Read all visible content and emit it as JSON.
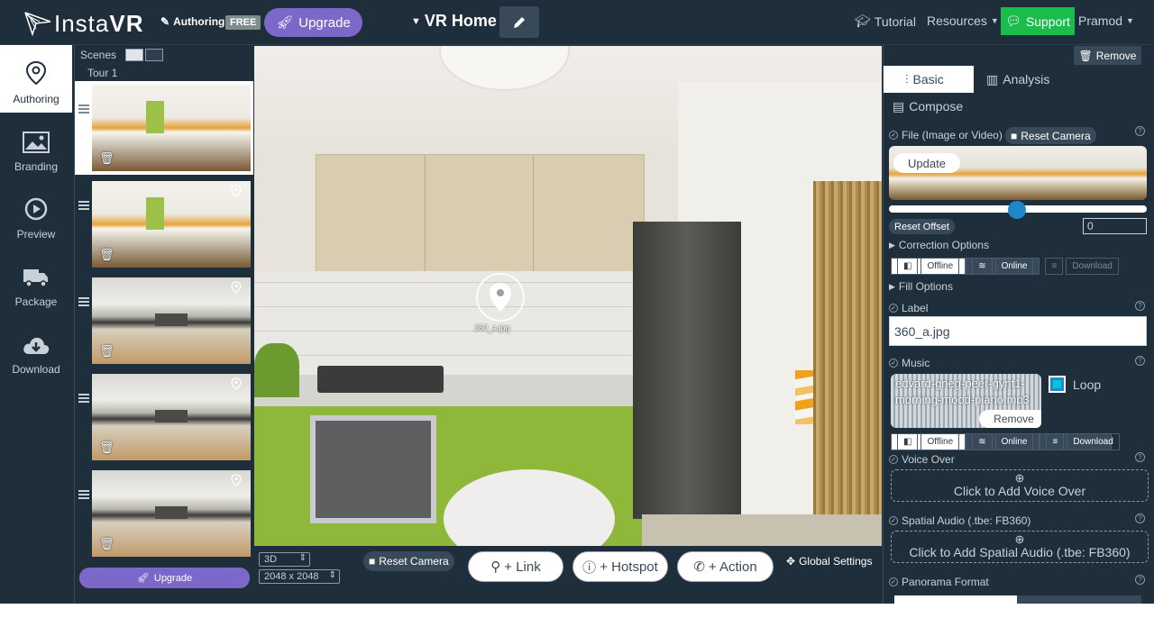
{
  "header": {
    "logo_text_light": "Insta",
    "logo_text_bold": "VR",
    "authoring_tag": "Authoring",
    "free_badge": "FREE",
    "upgrade_label": "Upgrade",
    "project_title": "VR Home",
    "tutorial_label": "Tutorial",
    "resources_label": "Resources",
    "support_label": "Support",
    "user_label": "Pramod"
  },
  "left_nav": {
    "items": [
      {
        "label": "Authoring",
        "icon": "location-pin-icon",
        "active": true
      },
      {
        "label": "Branding",
        "icon": "image-icon",
        "active": false
      },
      {
        "label": "Preview",
        "icon": "play-circle-icon",
        "active": false
      },
      {
        "label": "Package",
        "icon": "truck-icon",
        "active": false
      },
      {
        "label": "Download",
        "icon": "cloud-download-icon",
        "active": false
      }
    ]
  },
  "scenes": {
    "title": "Scenes",
    "tour_label": "Tour 1",
    "upgrade_label": "Upgrade",
    "items": [
      {
        "thumb": "warm",
        "selected": true,
        "pin": false
      },
      {
        "thumb": "warm",
        "selected": false,
        "pin": true
      },
      {
        "thumb": "cool",
        "selected": false,
        "pin": true
      },
      {
        "thumb": "cool",
        "selected": false,
        "pin": true
      },
      {
        "thumb": "cool",
        "selected": false,
        "pin": true
      }
    ]
  },
  "viewer": {
    "hotspot_label": "360_a.jpg",
    "mode_select": "3D",
    "resolution_select": "2048 x 2048",
    "reset_camera_label": "Reset Camera",
    "link_label": "+ Link",
    "hotspot_button_label": "+ Hotspot",
    "action_label": "+ Action",
    "global_settings_label": "Global Settings"
  },
  "right_panel": {
    "remove_label": "Remove",
    "tabs": {
      "basic": "Basic",
      "analysis": "Analysis",
      "compose": "Compose"
    },
    "file_label": "File (Image or Video)",
    "reset_camera_label": "Reset Camera",
    "update_label": "Update",
    "slider_value": 0.5,
    "reset_offset_label": "Reset Offset",
    "offset_value": "0",
    "correction_options_label": "Correction Options",
    "offline_label": "Offline",
    "online_label": "Online",
    "download_label": "Download",
    "fill_options_label": "Fill Options",
    "label_section": "Label",
    "label_value": "360_a.jpg",
    "music_section": "Music",
    "music_file": "edvard-grieg-peer-gynt1-morning-mood-piano.mp3",
    "music_remove_label": "Remove",
    "loop_label": "Loop",
    "loop_checked": true,
    "voice_over_section": "Voice Over",
    "voice_over_cta": "Click to Add Voice Over",
    "spatial_audio_section": "Spatial Audio (.tbe: FB360)",
    "spatial_audio_cta": "Click to Add Spatial Audio (.tbe: FB360)",
    "panorama_format_section": "Panorama Format"
  },
  "colors": {
    "background": "#1e2e3b",
    "accent_purple": "#7b68c9",
    "support_green": "#1bbc4b",
    "slider_blue": "#1e88c8"
  }
}
